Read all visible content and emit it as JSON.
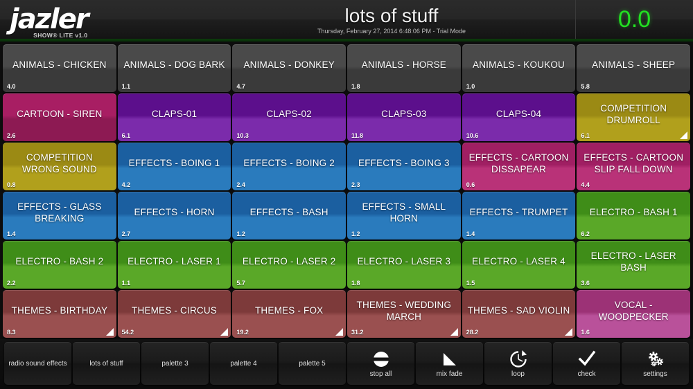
{
  "header": {
    "logo_text": "jazler",
    "logo_sub": "SHOW® LITE v1.0",
    "title": "lots of stuff",
    "subtitle": "Thursday, February 27, 2014 6:48:06 PM - Trial Mode",
    "counter": "0.0",
    "counter_color": "#22e022",
    "accent_line_color": "#0b3d0b"
  },
  "palette": {
    "colors": {
      "grey": [
        "#4a4a4a",
        "#3a3a3a"
      ],
      "magenta": [
        "#a81e63",
        "#8d1a53"
      ],
      "purple": [
        "#5c0f8c",
        "#7b2bab"
      ],
      "olive": [
        "#9b8a14",
        "#b1a01c"
      ],
      "blue": [
        "#1b5fa0",
        "#2a7bbd"
      ],
      "pink": [
        "#a01f63",
        "#b93278"
      ],
      "green": [
        "#3f8d18",
        "#5aa828"
      ],
      "brick": [
        "#7d3a3a",
        "#9a5050"
      ],
      "orchid": [
        "#9c3276",
        "#b9519a"
      ]
    },
    "rows": [
      [
        {
          "title": "ANIMALS - CHICKEN",
          "duration": "4.0",
          "color": "grey",
          "fade": false
        },
        {
          "title": "ANIMALS - DOG BARK",
          "duration": "1.1",
          "color": "grey",
          "fade": false
        },
        {
          "title": "ANIMALS - DONKEY",
          "duration": "4.7",
          "color": "grey",
          "fade": false
        },
        {
          "title": "ANIMALS - HORSE",
          "duration": "1.8",
          "color": "grey",
          "fade": false
        },
        {
          "title": "ANIMALS - KOUKOU",
          "duration": "1.0",
          "color": "grey",
          "fade": false
        },
        {
          "title": "ANIMALS - SHEEP",
          "duration": "5.8",
          "color": "grey",
          "fade": false
        }
      ],
      [
        {
          "title": "CARTOON - SIREN",
          "duration": "2.6",
          "color": "magenta",
          "fade": false
        },
        {
          "title": "CLAPS-01",
          "duration": "6.1",
          "color": "purple",
          "fade": false
        },
        {
          "title": "CLAPS-02",
          "duration": "10.3",
          "color": "purple",
          "fade": false
        },
        {
          "title": "CLAPS-03",
          "duration": "11.8",
          "color": "purple",
          "fade": false
        },
        {
          "title": "CLAPS-04",
          "duration": "10.6",
          "color": "purple",
          "fade": false
        },
        {
          "title": "COMPETITION DRUMROLL",
          "duration": "6.1",
          "color": "olive",
          "fade": true
        }
      ],
      [
        {
          "title": "COMPETITION WRONG SOUND",
          "duration": "0.8",
          "color": "olive",
          "fade": false
        },
        {
          "title": "EFFECTS - BOING 1",
          "duration": "4.2",
          "color": "blue",
          "fade": false
        },
        {
          "title": "EFFECTS - BOING 2",
          "duration": "2.4",
          "color": "blue",
          "fade": false
        },
        {
          "title": "EFFECTS - BOING 3",
          "duration": "2.3",
          "color": "blue",
          "fade": false
        },
        {
          "title": "EFFECTS - CARTOON DISSAPEAR",
          "duration": "0.6",
          "color": "pink",
          "fade": false
        },
        {
          "title": "EFFECTS - CARTOON SLIP FALL DOWN",
          "duration": "4.4",
          "color": "pink",
          "fade": false
        }
      ],
      [
        {
          "title": "EFFECTS - GLASS BREAKING",
          "duration": "1.4",
          "color": "blue",
          "fade": false
        },
        {
          "title": "EFFECTS - HORN",
          "duration": "2.7",
          "color": "blue",
          "fade": false
        },
        {
          "title": "EFFECTS - BASH",
          "duration": "1.2",
          "color": "blue",
          "fade": false
        },
        {
          "title": "EFFECTS - SMALL HORN",
          "duration": "1.2",
          "color": "blue",
          "fade": false
        },
        {
          "title": "EFFECTS - TRUMPET",
          "duration": "1.4",
          "color": "blue",
          "fade": false
        },
        {
          "title": "ELECTRO - BASH 1",
          "duration": "6.2",
          "color": "green",
          "fade": false
        }
      ],
      [
        {
          "title": "ELECTRO - BASH 2",
          "duration": "2.2",
          "color": "green",
          "fade": false
        },
        {
          "title": "ELECTRO - LASER 1",
          "duration": "1.1",
          "color": "green",
          "fade": false
        },
        {
          "title": "ELECTRO - LASER 2",
          "duration": "5.7",
          "color": "green",
          "fade": false
        },
        {
          "title": "ELECTRO - LASER 3",
          "duration": "1.8",
          "color": "green",
          "fade": false
        },
        {
          "title": "ELECTRO - LASER 4",
          "duration": "1.5",
          "color": "green",
          "fade": false
        },
        {
          "title": "ELECTRO - LASER BASH",
          "duration": "3.6",
          "color": "green",
          "fade": false
        }
      ],
      [
        {
          "title": "THEMES - BIRTHDAY",
          "duration": "8.3",
          "color": "brick",
          "fade": true
        },
        {
          "title": "THEMES - CIRCUS",
          "duration": "54.2",
          "color": "brick",
          "fade": true
        },
        {
          "title": "THEMES - FOX",
          "duration": "19.2",
          "color": "brick",
          "fade": true
        },
        {
          "title": "THEMES - WEDDING MARCH",
          "duration": "31.2",
          "color": "brick",
          "fade": true
        },
        {
          "title": "THEMES - SAD VIOLIN",
          "duration": "28.2",
          "color": "brick",
          "fade": true
        },
        {
          "title": "VOCAL - WOODPECKER",
          "duration": "1.6",
          "color": "orchid",
          "fade": false
        }
      ]
    ]
  },
  "bottombar": {
    "tabs": [
      {
        "label": "radio sound effects"
      },
      {
        "label": "lots of stuff"
      },
      {
        "label": "palette 3"
      },
      {
        "label": "palette 4"
      },
      {
        "label": "palette 5"
      }
    ],
    "actions": [
      {
        "label": "stop all",
        "icon": "stop-all-icon"
      },
      {
        "label": "mix fade",
        "icon": "mix-fade-icon"
      },
      {
        "label": "loop",
        "icon": "loop-icon"
      },
      {
        "label": "check",
        "icon": "check-icon"
      },
      {
        "label": "settings",
        "icon": "settings-gear-icon"
      }
    ]
  }
}
